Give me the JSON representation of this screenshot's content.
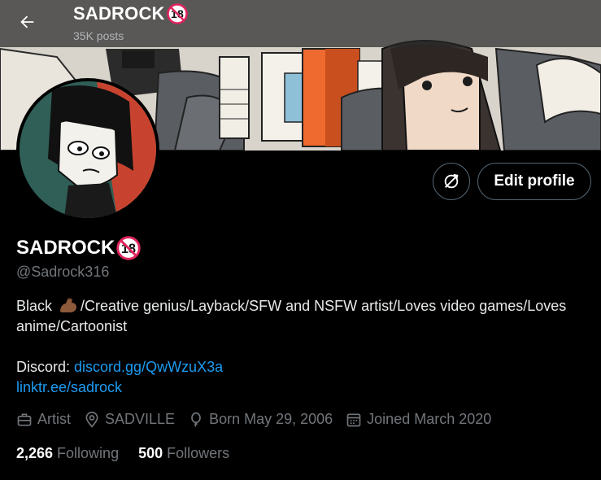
{
  "header": {
    "name": "SADROCK",
    "posts": "35K posts"
  },
  "profile": {
    "name": "SADROCK",
    "handle": "@Sadrock316",
    "edit_label": "Edit profile"
  },
  "bio": {
    "before_emoji": "Black ",
    "emoji": "flexed-biceps",
    "after_emoji": "/Creative genius/Layback/SFW and NSFW artist/Loves video games/Loves anime/Cartoonist",
    "discord_label": "Discord: ",
    "discord_link": "discord.gg/QwWzuX3a",
    "linktree": "linktr.ee/sadrock"
  },
  "meta": {
    "profession": "Artist",
    "location": "SADVILLE",
    "born": "Born May 29, 2006",
    "joined": "Joined March 2020"
  },
  "stats": {
    "following_count": "2,266",
    "following_label": "Following",
    "followers_count": "500",
    "followers_label": "Followers"
  },
  "colors": {
    "background": "#000000",
    "link": "#1d9bf0",
    "muted": "#71767b",
    "border": "#536471",
    "prohibited": "#e0245e"
  },
  "icons": [
    "back-arrow-icon",
    "no-18-icon",
    "sync-icon",
    "briefcase-icon",
    "location-pin-icon",
    "balloon-icon",
    "calendar-icon",
    "flexed-biceps-emoji"
  ]
}
